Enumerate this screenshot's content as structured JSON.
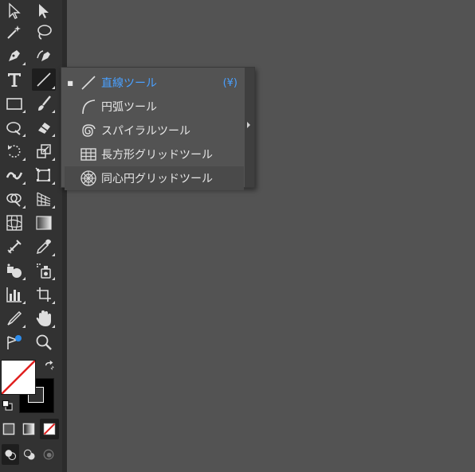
{
  "flyout": {
    "items": [
      {
        "label": "直線ツール",
        "shortcut": "(¥)",
        "selected": true,
        "icon": "line-segment-icon"
      },
      {
        "label": "円弧ツール",
        "shortcut": "",
        "selected": false,
        "icon": "arc-icon"
      },
      {
        "label": "スパイラルツール",
        "shortcut": "",
        "selected": false,
        "icon": "spiral-icon"
      },
      {
        "label": "長方形グリッドツール",
        "shortcut": "",
        "selected": false,
        "icon": "rectangular-grid-icon"
      },
      {
        "label": "同心円グリッドツール",
        "shortcut": "",
        "selected": false,
        "icon": "polar-grid-icon"
      }
    ]
  },
  "colors": {
    "accent": "#4aa0ff",
    "toolbar_bg": "#323232",
    "canvas_bg": "#535353",
    "none_red": "#e0201f"
  }
}
